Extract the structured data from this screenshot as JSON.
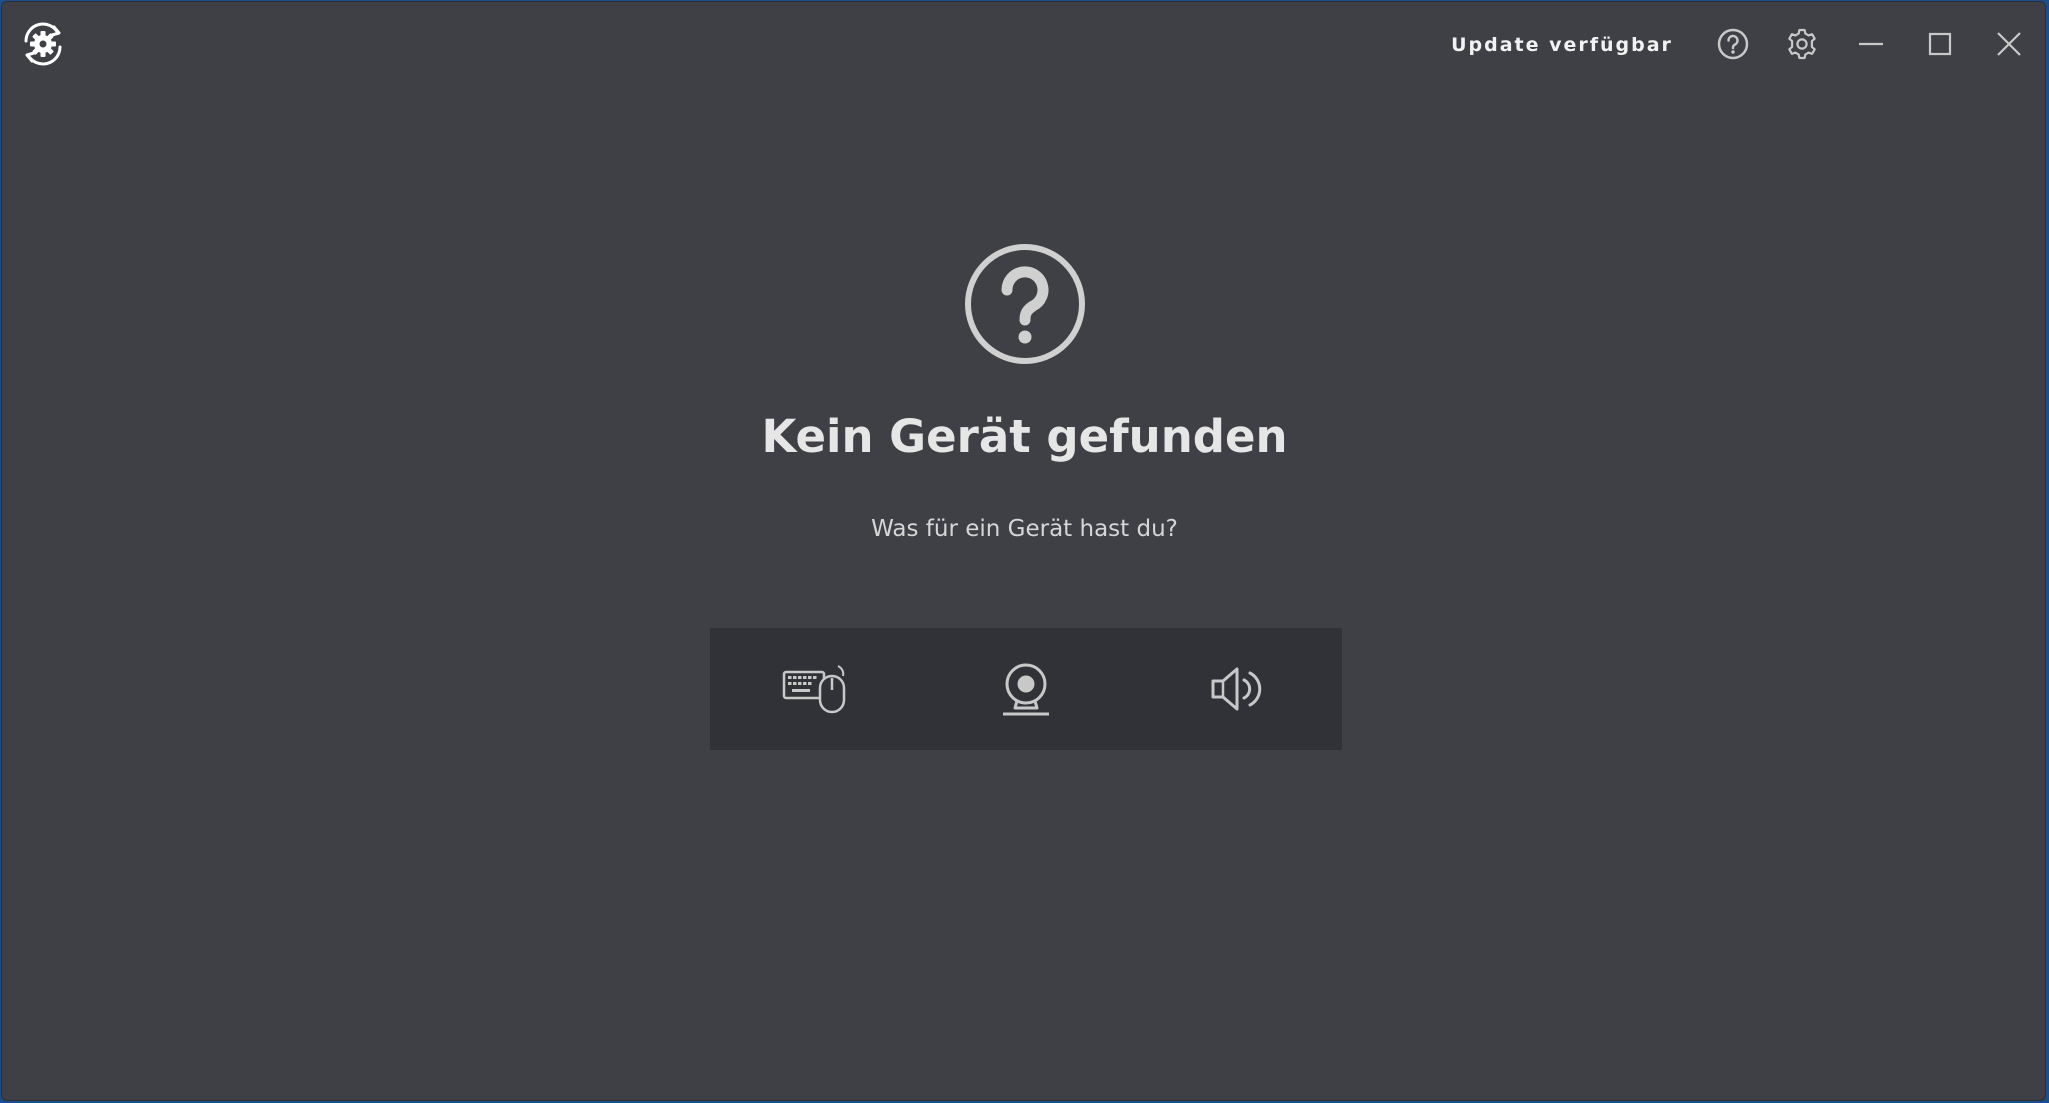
{
  "titlebar": {
    "update_label": "Update verfügbar",
    "logo_icon": "gear-sync-icon",
    "buttons": [
      "help-icon",
      "settings-icon",
      "minimize-icon",
      "maximize-icon",
      "close-icon"
    ]
  },
  "empty_state": {
    "icon": "question-circle-icon",
    "title": "Kein Gerät gefunden",
    "subtitle": "Was für ein Gerät hast du?"
  },
  "device_types": [
    {
      "icon": "keyboard-mouse-icon"
    },
    {
      "icon": "webcam-icon"
    },
    {
      "icon": "speaker-icon"
    }
  ],
  "colors": {
    "window_background": "#3e4046",
    "picker_background": "#303237",
    "text": "#e6e6e6",
    "icon": "#c8c8c8"
  }
}
